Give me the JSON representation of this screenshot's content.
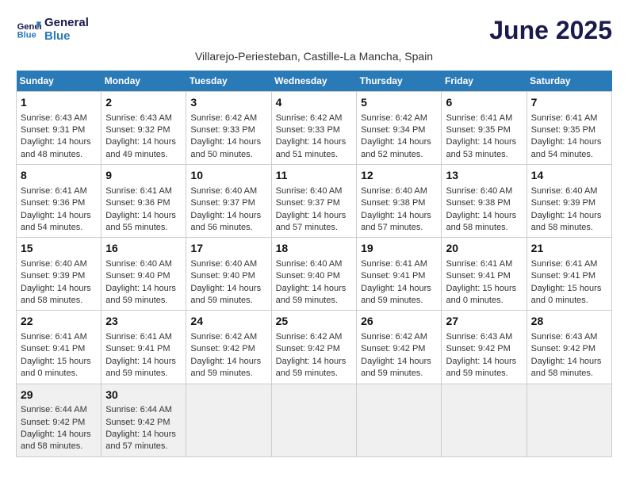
{
  "header": {
    "logo_line1": "General",
    "logo_line2": "Blue",
    "month": "June 2025",
    "location": "Villarejo-Periesteban, Castille-La Mancha, Spain"
  },
  "days_of_week": [
    "Sunday",
    "Monday",
    "Tuesday",
    "Wednesday",
    "Thursday",
    "Friday",
    "Saturday"
  ],
  "weeks": [
    [
      {
        "day": 1,
        "rise": "6:43 AM",
        "set": "9:31 PM",
        "hours": "14 hours and 48 minutes."
      },
      {
        "day": 2,
        "rise": "6:43 AM",
        "set": "9:32 PM",
        "hours": "14 hours and 49 minutes."
      },
      {
        "day": 3,
        "rise": "6:42 AM",
        "set": "9:33 PM",
        "hours": "14 hours and 50 minutes."
      },
      {
        "day": 4,
        "rise": "6:42 AM",
        "set": "9:33 PM",
        "hours": "14 hours and 51 minutes."
      },
      {
        "day": 5,
        "rise": "6:42 AM",
        "set": "9:34 PM",
        "hours": "14 hours and 52 minutes."
      },
      {
        "day": 6,
        "rise": "6:41 AM",
        "set": "9:35 PM",
        "hours": "14 hours and 53 minutes."
      },
      {
        "day": 7,
        "rise": "6:41 AM",
        "set": "9:35 PM",
        "hours": "14 hours and 54 minutes."
      }
    ],
    [
      {
        "day": 8,
        "rise": "6:41 AM",
        "set": "9:36 PM",
        "hours": "14 hours and 54 minutes."
      },
      {
        "day": 9,
        "rise": "6:41 AM",
        "set": "9:36 PM",
        "hours": "14 hours and 55 minutes."
      },
      {
        "day": 10,
        "rise": "6:40 AM",
        "set": "9:37 PM",
        "hours": "14 hours and 56 minutes."
      },
      {
        "day": 11,
        "rise": "6:40 AM",
        "set": "9:37 PM",
        "hours": "14 hours and 57 minutes."
      },
      {
        "day": 12,
        "rise": "6:40 AM",
        "set": "9:38 PM",
        "hours": "14 hours and 57 minutes."
      },
      {
        "day": 13,
        "rise": "6:40 AM",
        "set": "9:38 PM",
        "hours": "14 hours and 58 minutes."
      },
      {
        "day": 14,
        "rise": "6:40 AM",
        "set": "9:39 PM",
        "hours": "14 hours and 58 minutes."
      }
    ],
    [
      {
        "day": 15,
        "rise": "6:40 AM",
        "set": "9:39 PM",
        "hours": "14 hours and 58 minutes."
      },
      {
        "day": 16,
        "rise": "6:40 AM",
        "set": "9:40 PM",
        "hours": "14 hours and 59 minutes."
      },
      {
        "day": 17,
        "rise": "6:40 AM",
        "set": "9:40 PM",
        "hours": "14 hours and 59 minutes."
      },
      {
        "day": 18,
        "rise": "6:40 AM",
        "set": "9:40 PM",
        "hours": "14 hours and 59 minutes."
      },
      {
        "day": 19,
        "rise": "6:41 AM",
        "set": "9:41 PM",
        "hours": "14 hours and 59 minutes."
      },
      {
        "day": 20,
        "rise": "6:41 AM",
        "set": "9:41 PM",
        "hours": "15 hours and 0 minutes."
      },
      {
        "day": 21,
        "rise": "6:41 AM",
        "set": "9:41 PM",
        "hours": "15 hours and 0 minutes."
      }
    ],
    [
      {
        "day": 22,
        "rise": "6:41 AM",
        "set": "9:41 PM",
        "hours": "15 hours and 0 minutes."
      },
      {
        "day": 23,
        "rise": "6:41 AM",
        "set": "9:41 PM",
        "hours": "14 hours and 59 minutes."
      },
      {
        "day": 24,
        "rise": "6:42 AM",
        "set": "9:42 PM",
        "hours": "14 hours and 59 minutes."
      },
      {
        "day": 25,
        "rise": "6:42 AM",
        "set": "9:42 PM",
        "hours": "14 hours and 59 minutes."
      },
      {
        "day": 26,
        "rise": "6:42 AM",
        "set": "9:42 PM",
        "hours": "14 hours and 59 minutes."
      },
      {
        "day": 27,
        "rise": "6:43 AM",
        "set": "9:42 PM",
        "hours": "14 hours and 59 minutes."
      },
      {
        "day": 28,
        "rise": "6:43 AM",
        "set": "9:42 PM",
        "hours": "14 hours and 58 minutes."
      }
    ],
    [
      {
        "day": 29,
        "rise": "6:44 AM",
        "set": "9:42 PM",
        "hours": "14 hours and 58 minutes."
      },
      {
        "day": 30,
        "rise": "6:44 AM",
        "set": "9:42 PM",
        "hours": "14 hours and 57 minutes."
      },
      null,
      null,
      null,
      null,
      null
    ]
  ]
}
